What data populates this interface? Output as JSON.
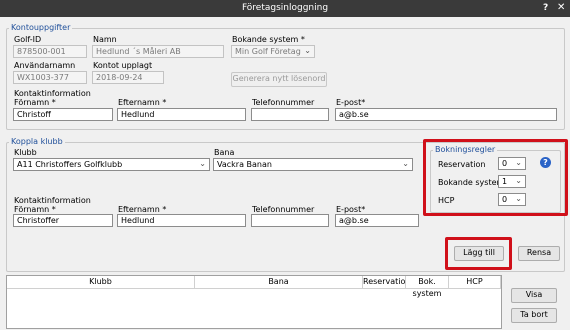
{
  "window": {
    "title": "Företagsinloggning",
    "help": "?",
    "close": "✕"
  },
  "kontouppgifter": {
    "legend": "Kontouppgifter",
    "golf_id_label": "Golf-ID",
    "golf_id": "878500-001",
    "namn_label": "Namn",
    "namn": "Hedlund ´s Måleri AB",
    "bokande_label": "Bokande system *",
    "bokande": "Min Golf Företag",
    "anvandarnamn_label": "Användarnamn",
    "anvandarnamn": "WX1003-377",
    "kontot_label": "Kontot upplagt",
    "kontot": "2018-09-24",
    "generera_button": "Generera nytt lösenord",
    "kontakt_header": "Kontaktinformation",
    "fornamn_label": "Förnamn *",
    "fornamn": "Christoff",
    "efternamn_label": "Efternamn *",
    "efternamn": "Hedlund",
    "telefon_label": "Telefonnummer",
    "telefon": "",
    "epost_label": "E-post*",
    "epost": "a@b.se"
  },
  "koppla": {
    "legend": "Koppla klubb",
    "klubb_label": "Klubb",
    "klubb": "A11 Christoffers Golfklubb",
    "bana_label": "Bana",
    "bana": "Vackra Banan",
    "kontakt_header": "Kontaktinformation",
    "fornamn_label": "Förnamn *",
    "fornamn": "Christoffer",
    "efternamn_label": "Efternamn *",
    "efternamn": "Hedlund",
    "telefon_label": "Telefonnummer",
    "telefon": "",
    "epost_label": "E-post*",
    "epost": "a@b.se"
  },
  "bokningsregler": {
    "legend": "Bokningsregler",
    "reservation_label": "Reservation",
    "reservation": "0",
    "bokande_label": "Bokande system",
    "bokande": "1",
    "hcp_label": "HCP",
    "hcp": "0",
    "help": "?"
  },
  "buttons": {
    "lagg_till": "Lägg till",
    "rensa": "Rensa",
    "visa": "Visa",
    "ta_bort": "Ta bort"
  },
  "table": {
    "columns": [
      "Klubb",
      "Bana",
      "Reservation",
      "Bok. system",
      "HCP"
    ]
  }
}
